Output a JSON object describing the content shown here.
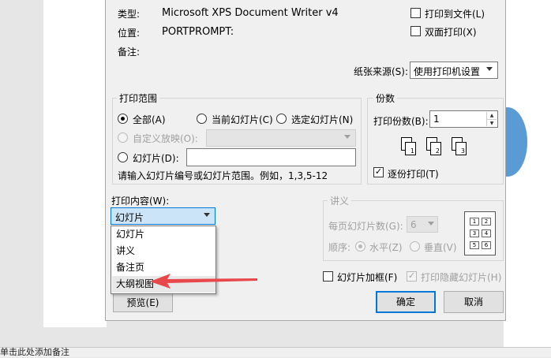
{
  "printer": {
    "type_label": "类型:",
    "type_value": "Microsoft XPS Document Writer v4",
    "location_label": "位置:",
    "location_value": "PORTPROMPT:",
    "comment_label": "备注:",
    "print_to_file": "打印到文件(L)",
    "duplex": "双面打印(X)",
    "paper_source_label": "纸张来源(S):",
    "paper_source_value": "使用打印机设置"
  },
  "range": {
    "legend": "打印范围",
    "all": "全部(A)",
    "current": "当前幻灯片(C)",
    "selection": "选定幻灯片(N)",
    "custom_show": "自定义放映(O):",
    "slides": "幻灯片(D):",
    "hint": "请输入幻灯片编号或幻灯片范围。例如，1,3,5-12"
  },
  "copies": {
    "legend": "份数",
    "count_label": "打印份数(B):",
    "count_value": "1",
    "collate": "逐份打印(T)",
    "collate_icon_labels": [
      "1",
      "2",
      "3"
    ]
  },
  "print_what": {
    "label": "打印内容(W):",
    "selected": "幻灯片",
    "options": [
      "幻灯片",
      "讲义",
      "备注页",
      "大纲视图"
    ],
    "highlighted_index": 3
  },
  "handouts": {
    "legend": "讲义",
    "per_page_label": "每页幻灯片数(G):",
    "per_page_value": "6",
    "order_label": "顺序:",
    "horizontal": "水平(Z)",
    "vertical": "垂直(V)",
    "preview_numbers": [
      "1",
      "2",
      "3",
      "4",
      "5",
      "6"
    ]
  },
  "options": {
    "frame_slides": "幻灯片加框(F)",
    "print_hidden": "打印隐藏幻灯片(H)"
  },
  "buttons": {
    "preview": "预览(E)",
    "ok": "确定",
    "cancel": "取消"
  },
  "background": {
    "status_text": "单击此处添加备注"
  },
  "colors": {
    "annotation_arrow": "#e8484b",
    "primary_button_border": "#0078d7",
    "combo_selected_bg": "#cce4f7"
  }
}
